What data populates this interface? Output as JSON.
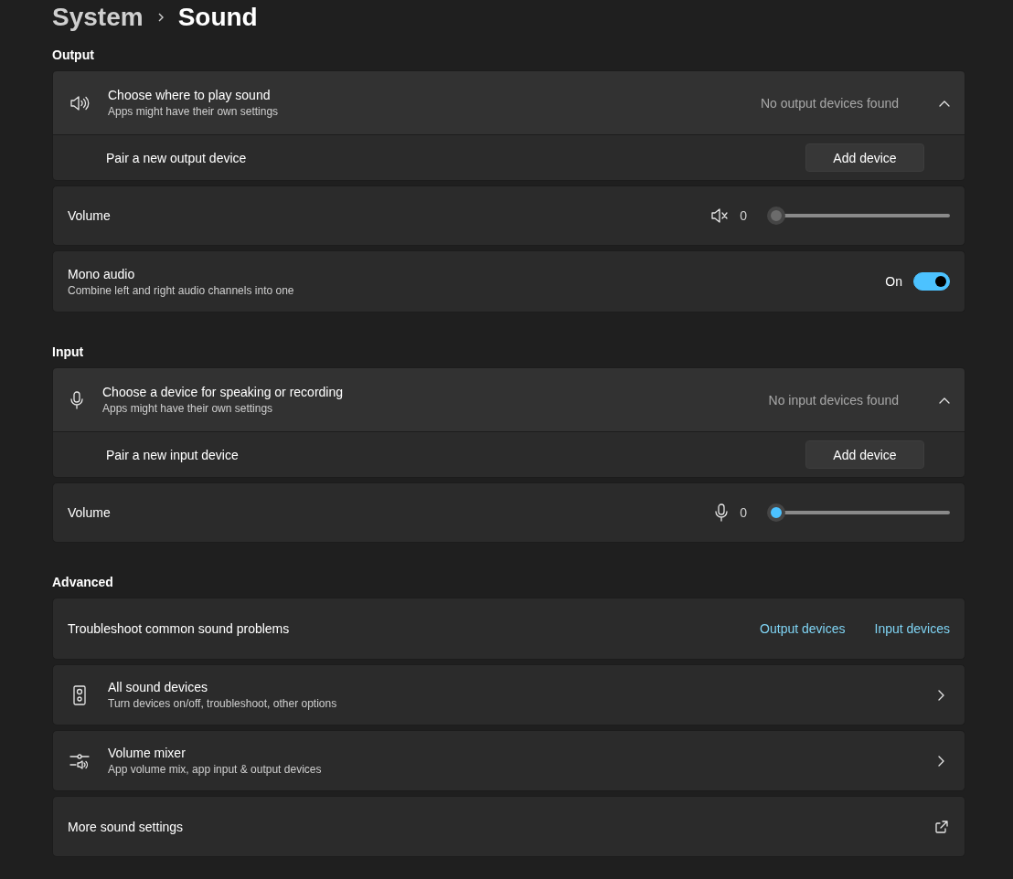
{
  "breadcrumb": {
    "parent": "System",
    "current": "Sound"
  },
  "sections": [
    {
      "kind": "output",
      "title": "Output",
      "items": [
        {
          "kind": "expander",
          "title": "Choose where to play sound",
          "subtitle": "Apps might have their own settings",
          "status": "No output devices found",
          "expanded": true,
          "child": {
            "label": "Pair a new output device",
            "button": "Add device"
          }
        },
        {
          "kind": "slider",
          "label": "Volume",
          "muted": true,
          "value": "0",
          "level": 0
        },
        {
          "kind": "toggle",
          "label": "Mono audio",
          "subtitle": "Combine left and right audio channels into one",
          "state": "On",
          "on": true
        }
      ]
    },
    {
      "kind": "input",
      "title": "Input",
      "items": [
        {
          "kind": "expander",
          "title": "Choose a device for speaking or recording",
          "subtitle": "Apps might have their own settings",
          "status": "No input devices found",
          "expanded": true,
          "child": {
            "label": "Pair a new input device",
            "button": "Add device"
          }
        },
        {
          "kind": "slider",
          "label": "Volume",
          "muted": false,
          "value": "0",
          "level": 0
        }
      ]
    },
    {
      "kind": "advanced",
      "title": "Advanced",
      "items": [
        {
          "kind": "links",
          "label": "Troubleshoot common sound problems",
          "links": [
            "Output devices",
            "Input devices"
          ]
        },
        {
          "kind": "nav",
          "title": "All sound devices",
          "subtitle": "Turn devices on/off, troubleshoot, other options"
        },
        {
          "kind": "nav",
          "title": "Volume mixer",
          "subtitle": "App volume mix, app input & output devices"
        },
        {
          "kind": "external",
          "label": "More sound settings"
        }
      ]
    }
  ]
}
